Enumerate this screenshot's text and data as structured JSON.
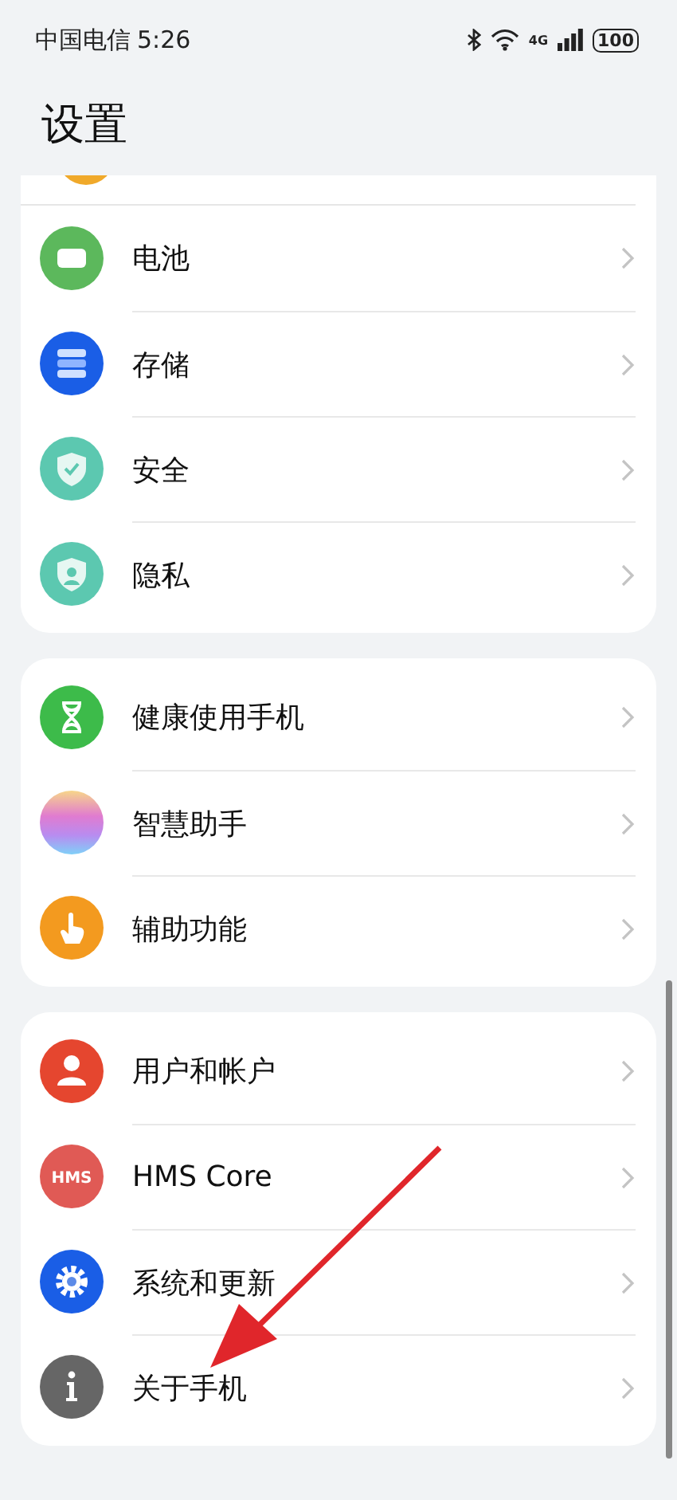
{
  "status_bar": {
    "carrier": "中国电信",
    "time": "5:26",
    "network": "4G",
    "battery": "100"
  },
  "title": "设置",
  "groups": [
    {
      "items": [
        {
          "label": "电池",
          "kind": "battery"
        },
        {
          "label": "存储",
          "kind": "storage"
        },
        {
          "label": "安全",
          "kind": "security"
        },
        {
          "label": "隐私",
          "kind": "privacy"
        }
      ]
    },
    {
      "items": [
        {
          "label": "健康使用手机",
          "kind": "hourglass"
        },
        {
          "label": "智慧助手",
          "kind": "assistant"
        },
        {
          "label": "辅助功能",
          "kind": "accessibility"
        }
      ]
    },
    {
      "items": [
        {
          "label": "用户和帐户",
          "kind": "user"
        },
        {
          "label": "HMS Core",
          "kind": "hms",
          "icon_text": "HMS"
        },
        {
          "label": "系统和更新",
          "kind": "gear"
        },
        {
          "label": "关于手机",
          "kind": "info"
        }
      ]
    }
  ]
}
